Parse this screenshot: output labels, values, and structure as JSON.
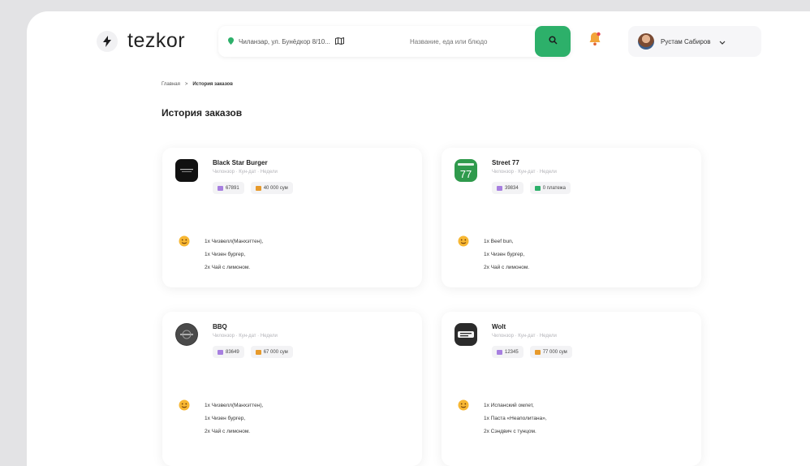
{
  "header": {
    "logo_text": "tezkor",
    "address": "Чиланзар, ул. Бунёдкор 8/10...",
    "search_placeholder": "Название, еда или блюдо",
    "user_name": "Рустам Сабиров"
  },
  "breadcrumb": {
    "home": "Главная",
    "separator": ">",
    "current": "История заказов"
  },
  "page_title": "История заказов",
  "orders": [
    {
      "name": "Black Star Burger",
      "meta": "Чилонзор · Кун-дат · Недели",
      "order_id": "67891",
      "amount": "40 000 сум",
      "items": [
        "1x Чизвелл(Манхэттен),",
        "1x Чизен бургер,",
        "2x Чай с лимоном."
      ]
    },
    {
      "name": "Street 77",
      "meta": "Чилонзор · Кун-дат · Недели",
      "order_id": "39834",
      "amount": "0 платежа",
      "items": [
        "1x Beef bun,",
        "1x Чизен бургер,",
        "2x Чай с лимоном."
      ]
    },
    {
      "name": "BBQ",
      "meta": "Чилонзор · Кун-дат · Недели",
      "order_id": "83649",
      "amount": "67 000 сум",
      "items": [
        "1x Чизвелл(Манхэттен),",
        "1x Чизен бургер,",
        "2x Чай с лимоном."
      ]
    },
    {
      "name": "Wolt",
      "meta": "Чилонзор · Кун-дат · Недели",
      "order_id": "12345",
      "amount": "77 000 сум",
      "items": [
        "1x Испанский омлет,",
        "1x Паста «Неаполитана»,",
        "2x Сэндвич с тунцом."
      ]
    }
  ],
  "colors": {
    "accent": "#2db06a",
    "id_chip": "#a77fe0",
    "price_chip": "#e79a2b"
  },
  "icons": [
    "bolt-icon",
    "location-pin-icon",
    "map-icon",
    "search-icon",
    "bell-icon",
    "chevron-down-icon",
    "emoji-icon"
  ]
}
